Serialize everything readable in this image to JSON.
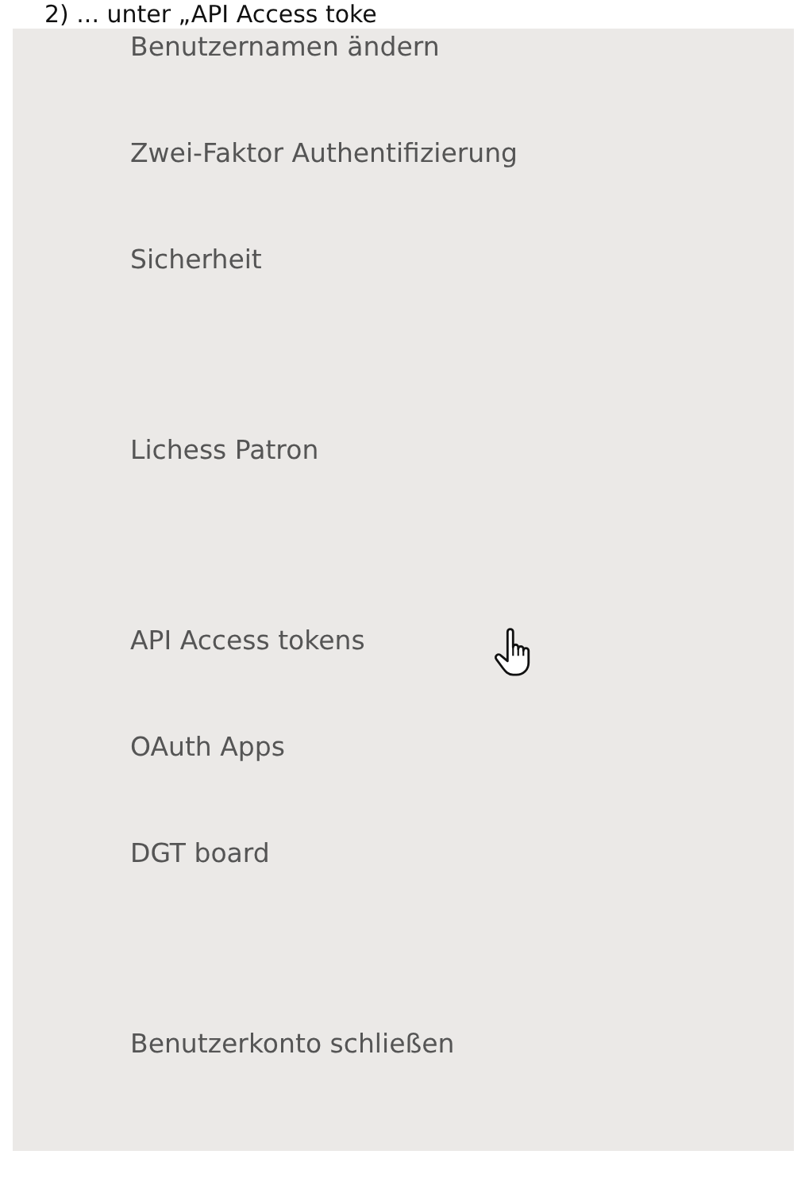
{
  "caption": "2) ... unter „API Access toke",
  "menu_groups": [
    {
      "items": [
        "Benutzernamen ändern",
        "Zwei-Faktor Authentifizierung",
        "Sicherheit"
      ]
    },
    {
      "items": [
        "Lichess Patron"
      ]
    },
    {
      "items": [
        "API Access tokens",
        "OAuth Apps",
        "DGT board"
      ]
    },
    {
      "items": [
        "Benutzerkonto schließen"
      ]
    }
  ]
}
